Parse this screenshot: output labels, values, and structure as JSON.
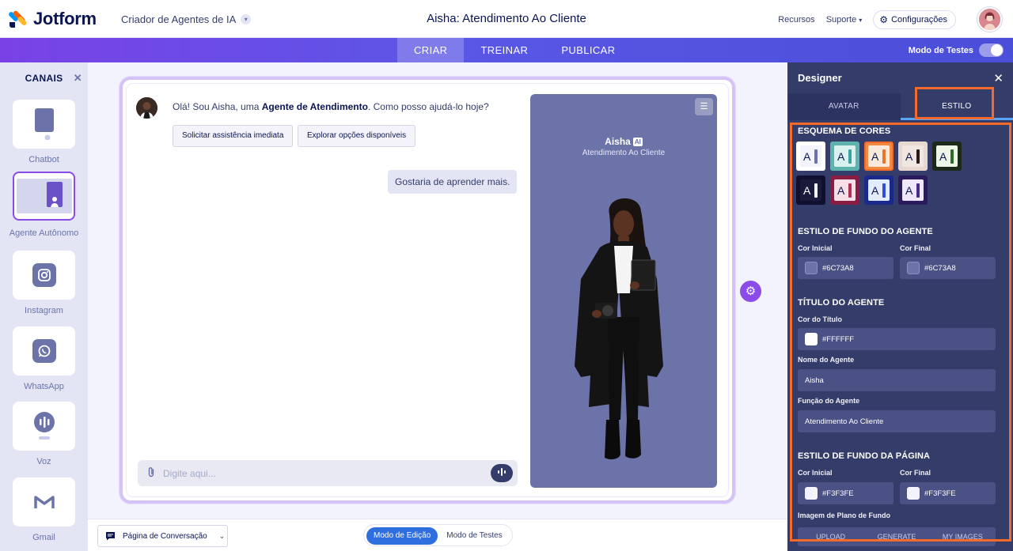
{
  "header": {
    "logo_text": "Jotform",
    "builder_label": "Criador de Agentes de IA",
    "title": "Aisha: Atendimento Ao Cliente",
    "links": [
      "Recursos",
      "Suporte",
      "Configurações"
    ]
  },
  "nav": {
    "tabs": [
      "CRIAR",
      "TREINAR",
      "PUBLICAR"
    ],
    "active_tab": "CRIAR",
    "test_mode_label": "Modo de Testes",
    "test_mode_on": false
  },
  "channels": {
    "title": "CANAIS",
    "items": [
      {
        "label": "Chatbot",
        "icon": "chatbot-icon"
      },
      {
        "label": "Agente Autônomo",
        "icon": "standalone-agent-icon",
        "selected": true
      },
      {
        "label": "Instagram",
        "icon": "instagram-icon"
      },
      {
        "label": "WhatsApp",
        "icon": "whatsapp-icon"
      },
      {
        "label": "Voz",
        "icon": "voice-icon"
      },
      {
        "label": "Gmail",
        "icon": "gmail-icon"
      }
    ]
  },
  "chat": {
    "greeting_prefix": "Olá! Sou Aisha, uma ",
    "greeting_bold": "Agente de Atendimento",
    "greeting_suffix": ". Como posso ajudá-lo hoje?",
    "quick_replies": [
      "Solicitar assistência imediata",
      "Explorar opções disponíveis"
    ],
    "user_message": "Gostaria de aprender mais.",
    "input_placeholder": "Digite aqui..."
  },
  "preview": {
    "agent_name": "Aisha",
    "ai_badge": "AI",
    "agent_role": "Atendimento Ao Cliente",
    "background": "#6C73A8"
  },
  "bottom": {
    "page_select": "Página de Conversação",
    "modes": [
      "Modo de Edição",
      "Modo de Testes"
    ],
    "active_mode": "Modo de Edição"
  },
  "designer": {
    "title": "Designer",
    "tabs": [
      "AVATAR",
      "ESTILO"
    ],
    "active_tab": "ESTILO",
    "color_scheme_title": "ESQUEMA DE CORES",
    "schemes": [
      {
        "letter": "A",
        "bg": "#f3f3fe",
        "bar": "#6c73a8",
        "fg": "#0a1551",
        "frame": "#ffffff"
      },
      {
        "letter": "A",
        "bg": "#d9f2f0",
        "bar": "#3aa3a0",
        "fg": "#0a1551",
        "frame": "#5fb3ad"
      },
      {
        "letter": "A",
        "bg": "#fbe9dc",
        "bar": "#e8762d",
        "fg": "#0a1551",
        "frame": "#f28a44",
        "selected": true
      },
      {
        "letter": "A",
        "bg": "#f1e7e2",
        "bar": "#2b1b18",
        "fg": "#0a1551",
        "frame": "#e6d8d1"
      },
      {
        "letter": "A",
        "bg": "#eef6e7",
        "bar": "#2f6b2d",
        "fg": "#0a1551",
        "frame": "#1d2a1b"
      },
      {
        "letter": "A",
        "bg": "#1a1b3c",
        "bar": "#f3f3fe",
        "fg": "#ffffff",
        "frame": "#0f1030"
      },
      {
        "letter": "A",
        "bg": "#f6dfe6",
        "bar": "#b0305a",
        "fg": "#0a1551",
        "frame": "#8a1d44"
      },
      {
        "letter": "A",
        "bg": "#e3ecff",
        "bar": "#2f4fd1",
        "fg": "#0a1551",
        "frame": "#1b2a8a"
      },
      {
        "letter": "A",
        "bg": "#efe7fb",
        "bar": "#4a2a8c",
        "fg": "#0a1551",
        "frame": "#2a1a5e"
      }
    ],
    "agent_bg_title": "ESTILO DE FUNDO DO AGENTE",
    "start_color_label": "Cor Inicial",
    "end_color_label": "Cor Final",
    "agent_bg_start": "#6C73A8",
    "agent_bg_end": "#6C73A8",
    "agent_title_section": "TÍTULO DO AGENTE",
    "title_color_label": "Cor do Título",
    "title_color": "#FFFFFF",
    "agent_name_label": "Nome do Agente",
    "agent_name": "Aisha",
    "agent_role_label": "Função do Agente",
    "agent_role": "Atendimento Ao Cliente",
    "page_bg_title": "ESTILO DE FUNDO DA PÁGINA",
    "page_bg_start": "#F3F3FE",
    "page_bg_end": "#F3F3FE",
    "bg_image_label": "Imagem de Plano de Fundo",
    "bg_image_tabs": [
      "UPLOAD",
      "GENERATE",
      "MY IMAGES"
    ]
  }
}
